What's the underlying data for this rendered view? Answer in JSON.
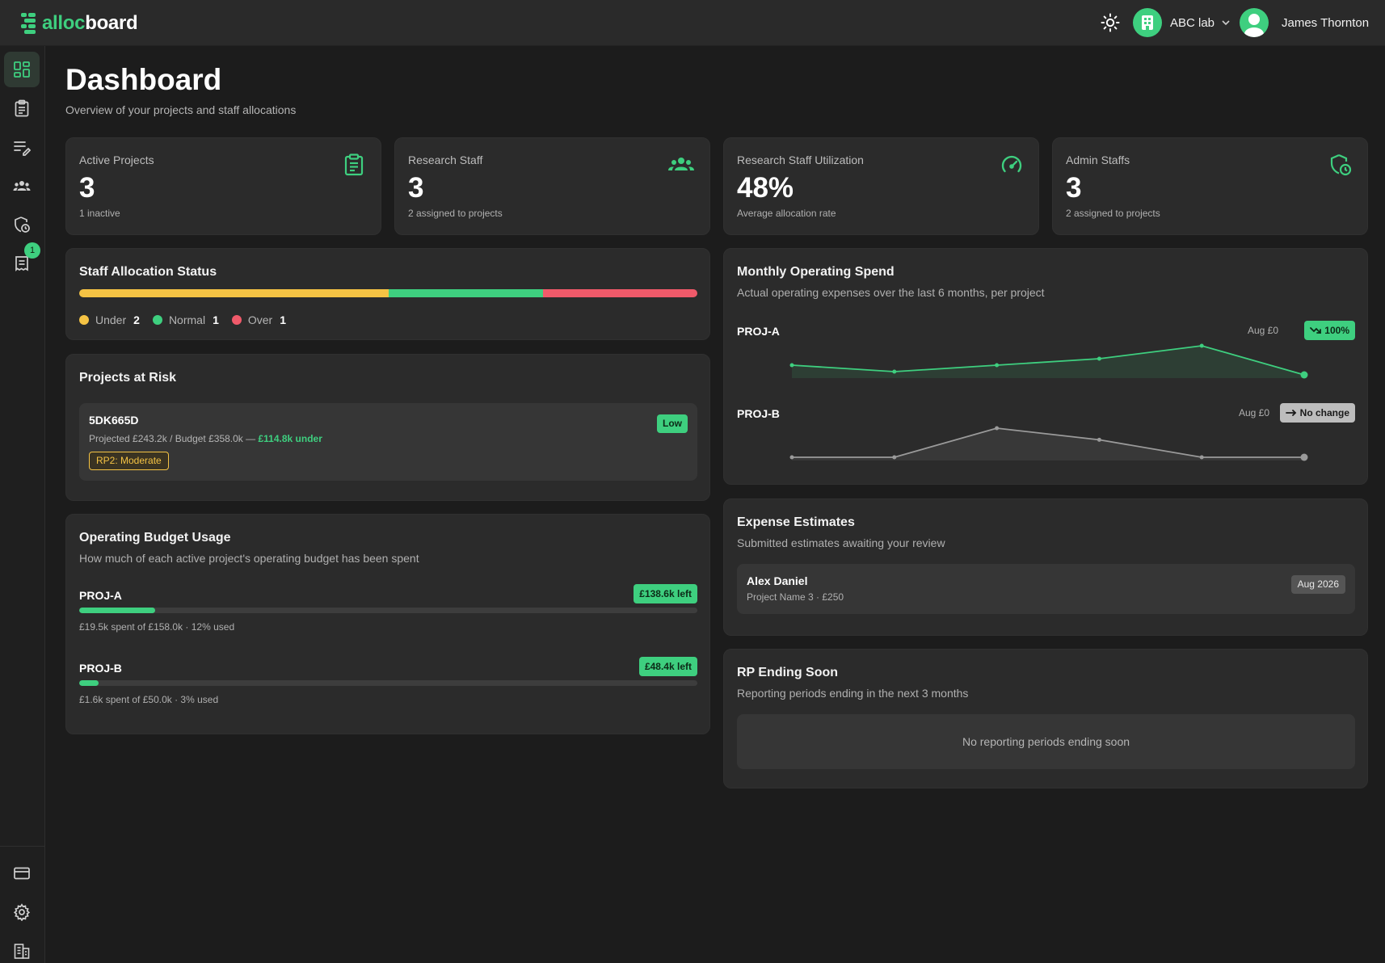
{
  "app": {
    "logo_prefix": "alloc",
    "logo_suffix": "board"
  },
  "header": {
    "org_name": "ABC lab",
    "user_name": "James Thornton"
  },
  "sidebar": {
    "items": [
      {
        "icon": "dashboard-icon",
        "active": true
      },
      {
        "icon": "clipboard-icon"
      },
      {
        "icon": "edit-list-icon"
      },
      {
        "icon": "team-icon"
      },
      {
        "icon": "shield-clock-icon"
      },
      {
        "icon": "report-icon",
        "badge": "1"
      }
    ],
    "bottom_items": [
      {
        "icon": "card-icon"
      },
      {
        "icon": "gear-icon"
      },
      {
        "icon": "building-icon"
      }
    ]
  },
  "page": {
    "title": "Dashboard",
    "subtitle": "Overview of your projects and staff allocations"
  },
  "stats": [
    {
      "label": "Active Projects",
      "value": "3",
      "note": "1 inactive",
      "icon": "clipboard-icon"
    },
    {
      "label": "Research Staff",
      "value": "3",
      "note": "2 assigned to projects",
      "icon": "team-icon"
    },
    {
      "label": "Research Staff Utilization",
      "value": "48%",
      "note": "Average allocation rate",
      "icon": "gauge-icon"
    },
    {
      "label": "Admin Staffs",
      "value": "3",
      "note": "2 assigned to projects",
      "icon": "shield-clock-icon"
    }
  ],
  "allocation": {
    "title": "Staff Allocation Status",
    "segments": [
      {
        "label": "Under",
        "count": "2",
        "color": "#f5c344",
        "fraction": 0.5
      },
      {
        "label": "Normal",
        "count": "1",
        "color": "#3ecf7f",
        "fraction": 0.25
      },
      {
        "label": "Over",
        "count": "1",
        "color": "#f05a6a",
        "fraction": 0.25
      }
    ]
  },
  "risk": {
    "title": "Projects at Risk",
    "item": {
      "code": "5DK665D",
      "detail_prefix": "Projected £243.2k / Budget £358.0k —",
      "detail_highlight": "£114.8k under",
      "tag": "RP2: Moderate",
      "badge": "Low"
    }
  },
  "budget": {
    "title": "Operating Budget Usage",
    "subtitle": "How much of each active project's operating budget has been spent",
    "rows": [
      {
        "name": "PROJ-A",
        "left": "£138.6k left",
        "note": "£19.5k spent of £158.0k · 12% used",
        "used_fraction": 0.123
      },
      {
        "name": "PROJ-B",
        "left": "£48.4k left",
        "note": "£1.6k spent of £50.0k · 3% used",
        "used_fraction": 0.032
      }
    ]
  },
  "spend": {
    "title": "Monthly Operating Spend",
    "subtitle": "Actual operating expenses over the last 6 months, per project",
    "rows": [
      {
        "name": "PROJ-A",
        "aug": "Aug £0",
        "pill": "100%",
        "pill_icon": "trend-down-icon",
        "pill_color": "#3ecf7f",
        "line_color": "#3ecf7f",
        "values": [
          3,
          1,
          3,
          5,
          9,
          0
        ]
      },
      {
        "name": "PROJ-B",
        "aug": "Aug £0",
        "pill": "No change",
        "pill_icon": "arrow-right-icon",
        "pill_color": "#bdbdbd",
        "line_color": "#9a9a9a",
        "values": [
          0,
          0,
          10,
          6,
          0,
          0
        ]
      }
    ]
  },
  "estimates": {
    "title": "Expense Estimates",
    "subtitle": "Submitted estimates awaiting your review",
    "item": {
      "name": "Alex Daniel",
      "detail": "Project Name 3 · £250",
      "badge": "Aug 2026"
    }
  },
  "rp": {
    "title": "RP Ending Soon",
    "subtitle": "Reporting periods ending in the next 3 months",
    "empty": "No reporting periods ending soon"
  }
}
